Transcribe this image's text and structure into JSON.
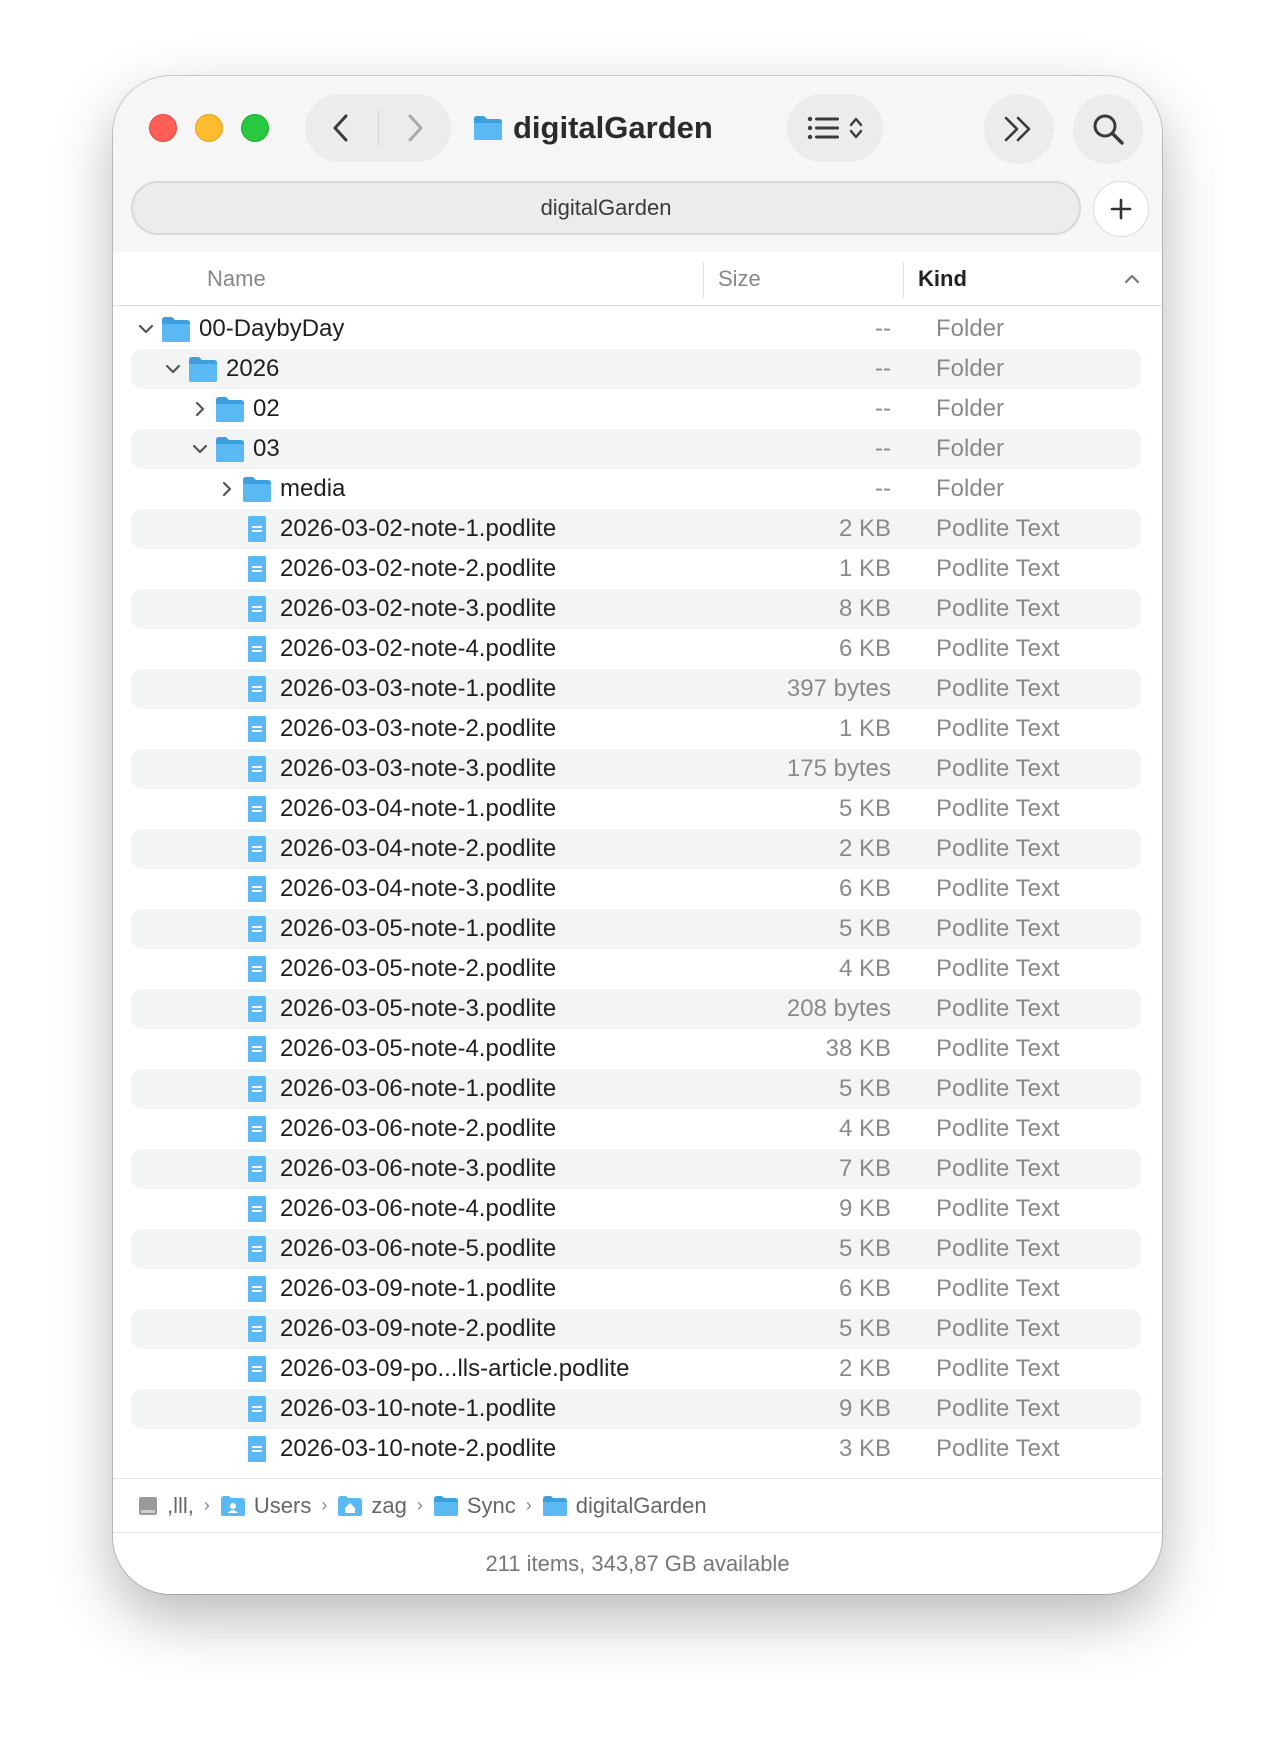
{
  "window": {
    "title": "digitalGarden",
    "path_bar_title": "digitalGarden"
  },
  "columns": {
    "name": "Name",
    "size": "Size",
    "kind": "Kind"
  },
  "rows": [
    {
      "name": "00-DaybyDay",
      "size": "--",
      "kind": "Folder",
      "type": "folder",
      "level": 0,
      "expanded": true
    },
    {
      "name": "2026",
      "size": "--",
      "kind": "Folder",
      "type": "folder",
      "level": 1,
      "expanded": true
    },
    {
      "name": "02",
      "size": "--",
      "kind": "Folder",
      "type": "folder",
      "level": 2,
      "expanded": false
    },
    {
      "name": "03",
      "size": "--",
      "kind": "Folder",
      "type": "folder",
      "level": 2,
      "expanded": true
    },
    {
      "name": "media",
      "size": "--",
      "kind": "Folder",
      "type": "folder",
      "level": 3,
      "expanded": false
    },
    {
      "name": "2026-03-02-note-1.podlite",
      "size": "2 KB",
      "kind": "Podlite Text",
      "type": "file",
      "level": 3
    },
    {
      "name": "2026-03-02-note-2.podlite",
      "size": "1 KB",
      "kind": "Podlite Text",
      "type": "file",
      "level": 3
    },
    {
      "name": "2026-03-02-note-3.podlite",
      "size": "8 KB",
      "kind": "Podlite Text",
      "type": "file",
      "level": 3
    },
    {
      "name": "2026-03-02-note-4.podlite",
      "size": "6 KB",
      "kind": "Podlite Text",
      "type": "file",
      "level": 3
    },
    {
      "name": "2026-03-03-note-1.podlite",
      "size": "397 bytes",
      "kind": "Podlite Text",
      "type": "file",
      "level": 3
    },
    {
      "name": "2026-03-03-note-2.podlite",
      "size": "1 KB",
      "kind": "Podlite Text",
      "type": "file",
      "level": 3
    },
    {
      "name": "2026-03-03-note-3.podlite",
      "size": "175 bytes",
      "kind": "Podlite Text",
      "type": "file",
      "level": 3
    },
    {
      "name": "2026-03-04-note-1.podlite",
      "size": "5 KB",
      "kind": "Podlite Text",
      "type": "file",
      "level": 3
    },
    {
      "name": "2026-03-04-note-2.podlite",
      "size": "2 KB",
      "kind": "Podlite Text",
      "type": "file",
      "level": 3
    },
    {
      "name": "2026-03-04-note-3.podlite",
      "size": "6 KB",
      "kind": "Podlite Text",
      "type": "file",
      "level": 3
    },
    {
      "name": "2026-03-05-note-1.podlite",
      "size": "5 KB",
      "kind": "Podlite Text",
      "type": "file",
      "level": 3
    },
    {
      "name": "2026-03-05-note-2.podlite",
      "size": "4 KB",
      "kind": "Podlite Text",
      "type": "file",
      "level": 3
    },
    {
      "name": "2026-03-05-note-3.podlite",
      "size": "208 bytes",
      "kind": "Podlite Text",
      "type": "file",
      "level": 3
    },
    {
      "name": "2026-03-05-note-4.podlite",
      "size": "38 KB",
      "kind": "Podlite Text",
      "type": "file",
      "level": 3
    },
    {
      "name": "2026-03-06-note-1.podlite",
      "size": "5 KB",
      "kind": "Podlite Text",
      "type": "file",
      "level": 3
    },
    {
      "name": "2026-03-06-note-2.podlite",
      "size": "4 KB",
      "kind": "Podlite Text",
      "type": "file",
      "level": 3
    },
    {
      "name": "2026-03-06-note-3.podlite",
      "size": "7 KB",
      "kind": "Podlite Text",
      "type": "file",
      "level": 3
    },
    {
      "name": "2026-03-06-note-4.podlite",
      "size": "9 KB",
      "kind": "Podlite Text",
      "type": "file",
      "level": 3
    },
    {
      "name": "2026-03-06-note-5.podlite",
      "size": "5 KB",
      "kind": "Podlite Text",
      "type": "file",
      "level": 3
    },
    {
      "name": "2026-03-09-note-1.podlite",
      "size": "6 KB",
      "kind": "Podlite Text",
      "type": "file",
      "level": 3
    },
    {
      "name": "2026-03-09-note-2.podlite",
      "size": "5 KB",
      "kind": "Podlite Text",
      "type": "file",
      "level": 3
    },
    {
      "name": "2026-03-09-po...lls-article.podlite",
      "size": "2 KB",
      "kind": "Podlite Text",
      "type": "file",
      "level": 3
    },
    {
      "name": "2026-03-10-note-1.podlite",
      "size": "9 KB",
      "kind": "Podlite Text",
      "type": "file",
      "level": 3
    },
    {
      "name": "2026-03-10-note-2.podlite",
      "size": "3 KB",
      "kind": "Podlite Text",
      "type": "file",
      "level": 3
    }
  ],
  "breadcrumb": [
    {
      "label": ",lll,",
      "icon": "disk-icon"
    },
    {
      "label": "Users",
      "icon": "users-folder-icon"
    },
    {
      "label": "zag",
      "icon": "home-folder-icon"
    },
    {
      "label": "Sync",
      "icon": "folder-icon"
    },
    {
      "label": "digitalGarden",
      "icon": "folder-icon"
    }
  ],
  "status": {
    "text": "211 items, 343,87 GB available"
  },
  "colors": {
    "folder": "#5ab9f2",
    "folder_dark": "#3e9fde",
    "file": "#5ab9f2",
    "close": "#ff5f57",
    "minimize": "#febc2e",
    "zoom": "#28c840"
  }
}
